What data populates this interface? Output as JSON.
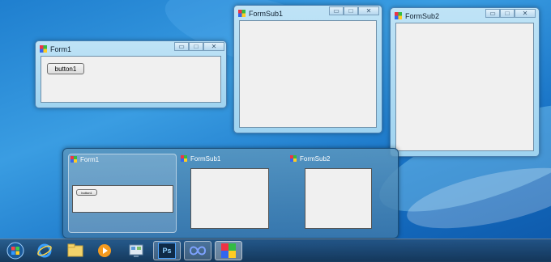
{
  "form1": {
    "title": "Form1",
    "button_label": "button1"
  },
  "formsub1": {
    "title": "FormSub1"
  },
  "formsub2": {
    "title": "FormSub2"
  },
  "title_buttons": {
    "minimize": "▭",
    "maximize": "□",
    "close": "✕"
  },
  "switcher": {
    "items": [
      {
        "label": "Form1",
        "button_label": "button1"
      },
      {
        "label": "FormSub1"
      },
      {
        "label": "FormSub2"
      }
    ]
  },
  "taskbar": {
    "start_icon": "windows-orb-icon",
    "items": [
      "internet-explorer-icon",
      "explorer-folder-icon",
      "media-player-icon",
      "control-panel-icon",
      "photoshop-icon",
      "visual-studio-icon",
      "winforms-app-icon"
    ],
    "photoshop_label": "Ps"
  },
  "colors": {
    "accent": "#3a9de2",
    "taskbar": "#1e3c5a"
  }
}
